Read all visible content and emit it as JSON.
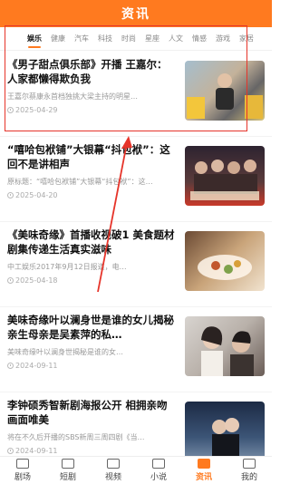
{
  "header": {
    "title": "资讯",
    "accent_color": "#ff7a1f"
  },
  "tabs": [
    {
      "label": "娱乐",
      "active": true
    },
    {
      "label": "健康"
    },
    {
      "label": "汽车"
    },
    {
      "label": "科技"
    },
    {
      "label": "时尚"
    },
    {
      "label": "星座"
    },
    {
      "label": "人文"
    },
    {
      "label": "情感"
    },
    {
      "label": "游戏"
    },
    {
      "label": "家居"
    }
  ],
  "articles": [
    {
      "headline": "《男子甜点俱乐部》开播 王嘉尔：人家都懒得欺负我",
      "summary": "王嘉尔蔡康永首档独挑大梁主持的明星…",
      "date": "2025-04-29"
    },
    {
      "headline": "“嘻哈包袱铺”大银幕“抖包袱”：这回不是讲相声",
      "summary": "原标题：“嘻哈包袱铺”大银幕“抖包袱”：这…",
      "date": "2025-04-20"
    },
    {
      "headline": "《美味奇缘》首播收视破1 美食题材剧集传递生活真实滋味",
      "summary": "中工娱乐2017年9月12日报道，电…",
      "date": "2025-04-18"
    },
    {
      "headline": "美味奇缘叶以澜身世是谁的女儿揭秘 亲生母亲是吴素萍的私…",
      "summary": "美味奇缘叶以澜身世揭秘是谁的女…",
      "date": "2024-09-11"
    },
    {
      "headline": "李钟硕秀智新剧海报公开 相拥亲吻画面唯美",
      "summary": "将在不久后开播的SBS新周三周四剧《当…",
      "date": "2024-09-11"
    }
  ],
  "bottom_nav": [
    {
      "label": "剧场",
      "icon": "theater-icon"
    },
    {
      "label": "短剧",
      "icon": "short-drama-icon"
    },
    {
      "label": "视频",
      "icon": "video-icon"
    },
    {
      "label": "小说",
      "icon": "book-icon"
    },
    {
      "label": "资讯",
      "icon": "news-icon",
      "active": true
    },
    {
      "label": "我的",
      "icon": "profile-icon"
    }
  ]
}
